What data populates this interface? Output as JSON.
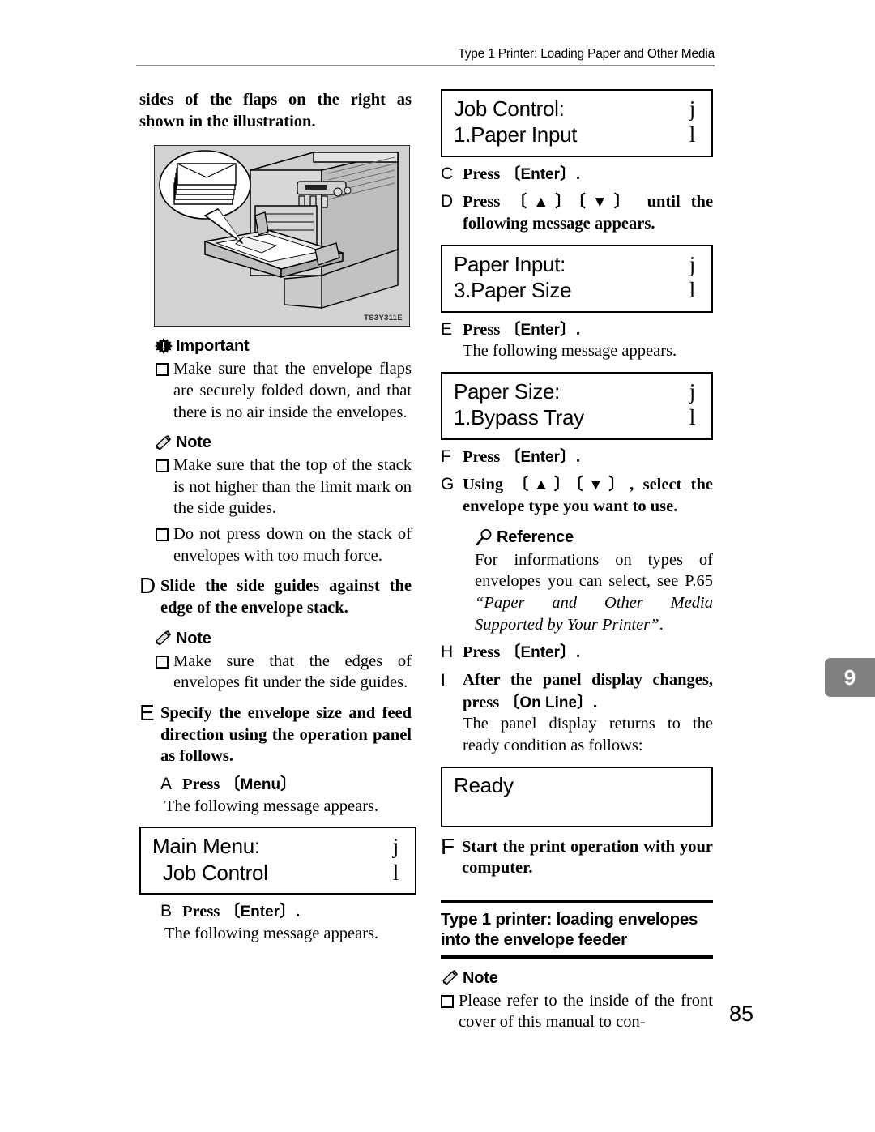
{
  "header": {
    "title": "Type 1 Printer: Loading Paper and Other Media"
  },
  "chapter_tab": "9",
  "page_number": "85",
  "figure": {
    "id": "TS3Y311E",
    "alt": "printer-bypass-tray-envelope-loading"
  },
  "left_column": {
    "continued_paragraph": "sides of the flaps on the right as shown in the illustration.",
    "important": {
      "label": "Important",
      "icon": "important-starburst-icon",
      "items": [
        "Make sure that the envelope flaps are securely folded down, and that there is no air inside the envelopes."
      ]
    },
    "note_1": {
      "label": "Note",
      "icon": "note-pencil-icon",
      "items": [
        "Make sure that the top of the stack is not higher than the limit mark on the side guides.",
        "Do not press down on the stack of envelopes with too much force."
      ]
    },
    "step_d": {
      "letter": "D",
      "text": "Slide the side guides against the edge of the envelope stack."
    },
    "note_2": {
      "label": "Note",
      "icon": "note-pencil-icon",
      "items": [
        "Make sure that the edges of envelopes fit under the side guides."
      ]
    },
    "step_e": {
      "letter": "E",
      "text": "Specify the envelope size and feed direction using the operation panel as follows."
    },
    "substep_a": {
      "letter": "A",
      "press_word": "Press",
      "key": "Menu",
      "trailing": ""
    },
    "message_intro_a": "The following message appears.",
    "lcd_main_menu": {
      "line1": "Main Menu:",
      "line2": "Job Control",
      "arrow_up": "j",
      "arrow_down": "l"
    },
    "substep_b": {
      "letter": "B",
      "press_word": "Press",
      "key": "Enter",
      "trailing": "."
    },
    "message_intro_b": "The following message appears."
  },
  "right_column": {
    "lcd_job_control": {
      "line1": "Job Control:",
      "line2": "1.Paper Input",
      "arrow_up": "j",
      "arrow_down": "l"
    },
    "substep_c": {
      "letter": "C",
      "press_word": "Press",
      "key": "Enter",
      "trailing": "."
    },
    "substep_d": {
      "letter": "D",
      "press_word": "Press",
      "key_up": "▲",
      "key_down": "▼",
      "tail": " until the following message appears."
    },
    "lcd_paper_input": {
      "line1": "Paper Input:",
      "line2": "3.Paper Size",
      "arrow_up": "j",
      "arrow_down": "l"
    },
    "substep_e": {
      "letter": "E",
      "press_word": "Press",
      "key": "Enter",
      "trailing": "."
    },
    "message_intro_e": "The following message appears.",
    "lcd_paper_size": {
      "line1": "Paper Size:",
      "line2": "1.Bypass Tray",
      "arrow_up": "j",
      "arrow_down": "l"
    },
    "substep_f": {
      "letter": "F",
      "press_word": "Press",
      "key": "Enter",
      "trailing": "."
    },
    "substep_g": {
      "letter": "G",
      "lead": "Using ",
      "key_up": "▲",
      "key_down": "▼",
      "tail": ", select the envelope type you want to use."
    },
    "reference": {
      "label": "Reference",
      "icon": "reference-magnifier-icon",
      "text_plain_1": "For informations on types of envelopes you can select, see P.65 ",
      "text_italic": "“Paper and Other Media Supported by Your Printer”",
      "text_plain_2": "."
    },
    "substep_h": {
      "letter": "H",
      "press_word": "Press",
      "key": "Enter",
      "trailing": "."
    },
    "substep_i": {
      "letter": "I",
      "lead": "After the panel display changes, press ",
      "key": "On Line",
      "trailing": "."
    },
    "panel_returns_text": "The panel display returns to the ready condition as follows:",
    "lcd_ready": {
      "line1": "Ready"
    },
    "step_f": {
      "letter": "F",
      "text": "Start the print operation with your computer."
    },
    "section_heading": "Type 1 printer: loading envelopes into the envelope feeder",
    "note_3": {
      "label": "Note",
      "icon": "note-pencil-icon",
      "items": [
        "Please refer to the inside of the front cover of this manual to con-"
      ]
    }
  }
}
